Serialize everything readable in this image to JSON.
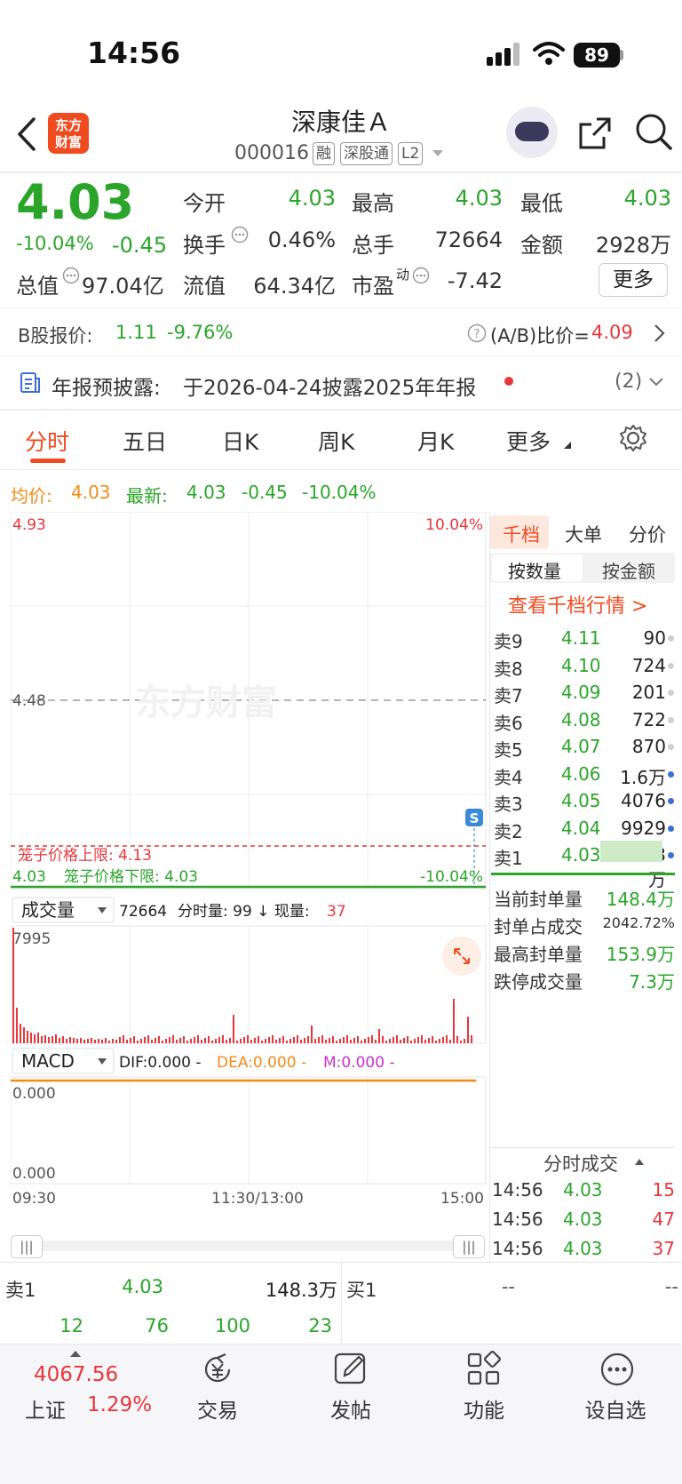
{
  "status": {
    "time": "14:56",
    "battery": "89"
  },
  "header": {
    "logo": "东方\n财富",
    "name": "深康佳Ａ",
    "code": "000016",
    "tags": [
      "融",
      "深股通",
      "L2"
    ]
  },
  "quote": {
    "price": "4.03",
    "change_pct": "-10.04%",
    "change": "-0.45",
    "open_label": "今开",
    "open": "4.03",
    "high_label": "最高",
    "high": "4.03",
    "low_label": "最低",
    "low": "4.03",
    "turnover_label": "换手",
    "turnover": "0.46%",
    "volume_label": "总手",
    "volume": "72664",
    "amount_label": "金额",
    "amount": "2928万",
    "mktcap_label": "总值",
    "mktcap": "97.04亿",
    "float_label": "流值",
    "float": "64.34亿",
    "pe_label": "市盈",
    "pe_sup": "动",
    "pe": "-7.42",
    "more": "更多"
  },
  "bshare": {
    "label": "B股报价:",
    "price": "1.11",
    "pct": "-9.76%",
    "ratio_label": "(A/B)比价=",
    "ratio": "4.09"
  },
  "notice": {
    "label": "年报预披露:",
    "text": "于2026-04-24披露2025年年报",
    "count": "(2)"
  },
  "tabs": [
    "分时",
    "五日",
    "日K",
    "周K",
    "月K",
    "更多"
  ],
  "chart": {
    "avg_label": "均价:",
    "avg": "4.03",
    "latest_label": "最新:",
    "latest": "4.03",
    "latest_chg": "-0.45",
    "latest_pct": "-10.04%",
    "y_top": "4.93",
    "y_top_pct": "10.04%",
    "y_mid": "4.48",
    "y_bottom": "4.03",
    "y_bottom_pct": "-10.04%",
    "cage_upper": "笼子价格上限: 4.13",
    "cage_lower": "笼子价格下限: 4.03",
    "watermark": "东方财富",
    "badge": "S",
    "vol_select": "成交量",
    "vol_total": "72664",
    "vol_info": "分时量: 99 ↓ 现量:",
    "vol_now": "37",
    "vol_max": "7995",
    "macd_select": "MACD",
    "dif": "DIF:0.000 -",
    "dea": "DEA:0.000 -",
    "m": "M:0.000 -",
    "macd_top": "0.000",
    "macd_bottom": "0.000",
    "time_start": "09:30",
    "time_mid": "11:30/13:00",
    "time_end": "15:00"
  },
  "orderbook": {
    "tabs": [
      "千档",
      "大单",
      "分价"
    ],
    "sub_tabs": [
      "按数量",
      "按金额"
    ],
    "link": "查看千档行情 >",
    "asks": [
      {
        "label": "卖9",
        "price": "4.11",
        "vol": "90"
      },
      {
        "label": "卖8",
        "price": "4.10",
        "vol": "724"
      },
      {
        "label": "卖7",
        "price": "4.09",
        "vol": "201"
      },
      {
        "label": "卖6",
        "price": "4.08",
        "vol": "722"
      },
      {
        "label": "卖5",
        "price": "4.07",
        "vol": "870"
      },
      {
        "label": "卖4",
        "price": "4.06",
        "vol": "1.6万"
      },
      {
        "label": "卖3",
        "price": "4.05",
        "vol": "4076"
      },
      {
        "label": "卖2",
        "price": "4.04",
        "vol": "9929"
      },
      {
        "label": "卖1",
        "price": "4.03",
        "vol": "148.3万"
      }
    ],
    "stats": [
      {
        "label": "当前封单量",
        "value": "148.4万"
      },
      {
        "label": "封单占成交",
        "value": "2042.72%"
      },
      {
        "label": "最高封单量",
        "value": "153.9万"
      },
      {
        "label": "跌停成交量",
        "value": "7.3万"
      }
    ],
    "trades_title": "分时成交",
    "trades": [
      {
        "time": "14:56",
        "price": "4.03",
        "vol": "15"
      },
      {
        "time": "14:56",
        "price": "4.03",
        "vol": "47"
      },
      {
        "time": "14:56",
        "price": "4.03",
        "vol": "37"
      }
    ]
  },
  "level": {
    "sell_label": "卖1",
    "sell_price": "4.03",
    "sell_vol": "148.3万",
    "buy_label": "买1",
    "buy_price": "--",
    "buy_vol": "--",
    "queue": [
      "12",
      "76",
      "100",
      "23"
    ]
  },
  "bottom_nav": {
    "index_value": "4067.56",
    "index_name": "上证",
    "index_pct": "1.29%",
    "items": [
      "交易",
      "发帖",
      "功能",
      "设自选"
    ]
  }
}
